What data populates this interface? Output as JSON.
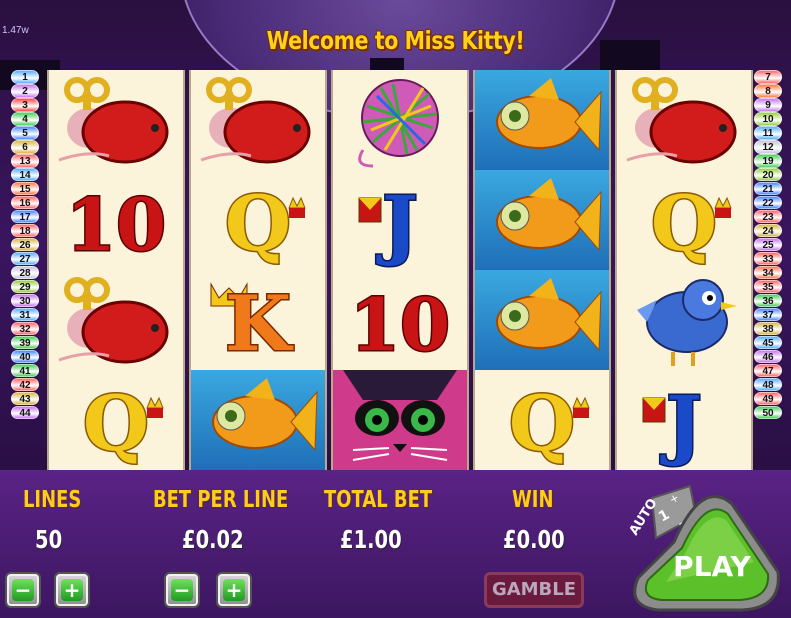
{
  "overlay": {
    "fps_text": "1.47w"
  },
  "header": {
    "title": "Welcome to Miss Kitty!"
  },
  "paylines": {
    "left": [
      {
        "n": "1",
        "c": "#5ab0ff"
      },
      {
        "n": "2",
        "c": "#c87af0"
      },
      {
        "n": "3",
        "c": "#ff4a4a"
      },
      {
        "n": "4",
        "c": "#4ad05a"
      },
      {
        "n": "5",
        "c": "#4a8cff"
      },
      {
        "n": "6",
        "c": "#d8b84a"
      },
      {
        "n": "13",
        "c": "#ff6a6a"
      },
      {
        "n": "14",
        "c": "#5ab0ff"
      },
      {
        "n": "15",
        "c": "#ff7a4a"
      },
      {
        "n": "16",
        "c": "#ff6a6a"
      },
      {
        "n": "17",
        "c": "#4a8cff"
      },
      {
        "n": "18",
        "c": "#ff6a6a"
      },
      {
        "n": "26",
        "c": "#d8b84a"
      },
      {
        "n": "27",
        "c": "#5ab0ff"
      },
      {
        "n": "28",
        "c": "#c8c8d8"
      },
      {
        "n": "29",
        "c": "#9ad04a"
      },
      {
        "n": "30",
        "c": "#c87af0"
      },
      {
        "n": "31",
        "c": "#5ab0ff"
      },
      {
        "n": "32",
        "c": "#ff6a6a"
      },
      {
        "n": "39",
        "c": "#4ad05a"
      },
      {
        "n": "40",
        "c": "#4a8cff"
      },
      {
        "n": "41",
        "c": "#4ad05a"
      },
      {
        "n": "42",
        "c": "#ff6a6a"
      },
      {
        "n": "43",
        "c": "#d8b84a"
      },
      {
        "n": "44",
        "c": "#c87af0"
      }
    ],
    "right": [
      {
        "n": "7",
        "c": "#ff6a6a"
      },
      {
        "n": "8",
        "c": "#ff7a4a"
      },
      {
        "n": "9",
        "c": "#c87af0"
      },
      {
        "n": "10",
        "c": "#9ad04a"
      },
      {
        "n": "11",
        "c": "#5ab0ff"
      },
      {
        "n": "12",
        "c": "#c8c8d8"
      },
      {
        "n": "19",
        "c": "#4ad05a"
      },
      {
        "n": "20",
        "c": "#9ad04a"
      },
      {
        "n": "21",
        "c": "#4a8cff"
      },
      {
        "n": "22",
        "c": "#4a8cff"
      },
      {
        "n": "23",
        "c": "#ff6a6a"
      },
      {
        "n": "24",
        "c": "#d8b84a"
      },
      {
        "n": "25",
        "c": "#c87af0"
      },
      {
        "n": "33",
        "c": "#ff6a6a"
      },
      {
        "n": "34",
        "c": "#ff7a4a"
      },
      {
        "n": "35",
        "c": "#ff6a6a"
      },
      {
        "n": "36",
        "c": "#4ad05a"
      },
      {
        "n": "37",
        "c": "#4a8cff"
      },
      {
        "n": "38",
        "c": "#d8b84a"
      },
      {
        "n": "45",
        "c": "#5ab0ff"
      },
      {
        "n": "46",
        "c": "#c87af0"
      },
      {
        "n": "47",
        "c": "#ff6a6a"
      },
      {
        "n": "48",
        "c": "#5ab0ff"
      },
      {
        "n": "49",
        "c": "#ff6a6a"
      },
      {
        "n": "50",
        "c": "#4ad05a"
      }
    ]
  },
  "reels": [
    [
      "wind-up-mouse",
      "ten",
      "wind-up-mouse",
      "queen"
    ],
    [
      "wind-up-mouse",
      "queen",
      "king",
      "goldfish"
    ],
    [
      "yarn-ball",
      "jack",
      "ten",
      "miss-kitty-cat"
    ],
    [
      "goldfish",
      "goldfish",
      "goldfish",
      "queen"
    ],
    [
      "wind-up-mouse",
      "queen",
      "bluebird",
      "jack"
    ]
  ],
  "symbol_text": {
    "ten": "10",
    "queen": "Q",
    "king": "K",
    "jack": "J"
  },
  "stats": {
    "lines_label": "LINES",
    "lines_value": "50",
    "bet_label": "BET PER LINE",
    "bet_value": "£0.02",
    "total_label": "TOTAL BET",
    "total_value": "£1.00",
    "win_label": "WIN",
    "win_value": "£0.00"
  },
  "controls": {
    "minus": "−",
    "plus": "+",
    "gamble_label": "GAMBLE",
    "auto_label": "AUTO",
    "auto_count": "1",
    "play_label": "PLAY"
  },
  "colors": {
    "title": "#ffd21a",
    "label": "#ffcc1a",
    "play_green": "#5cc02a"
  }
}
